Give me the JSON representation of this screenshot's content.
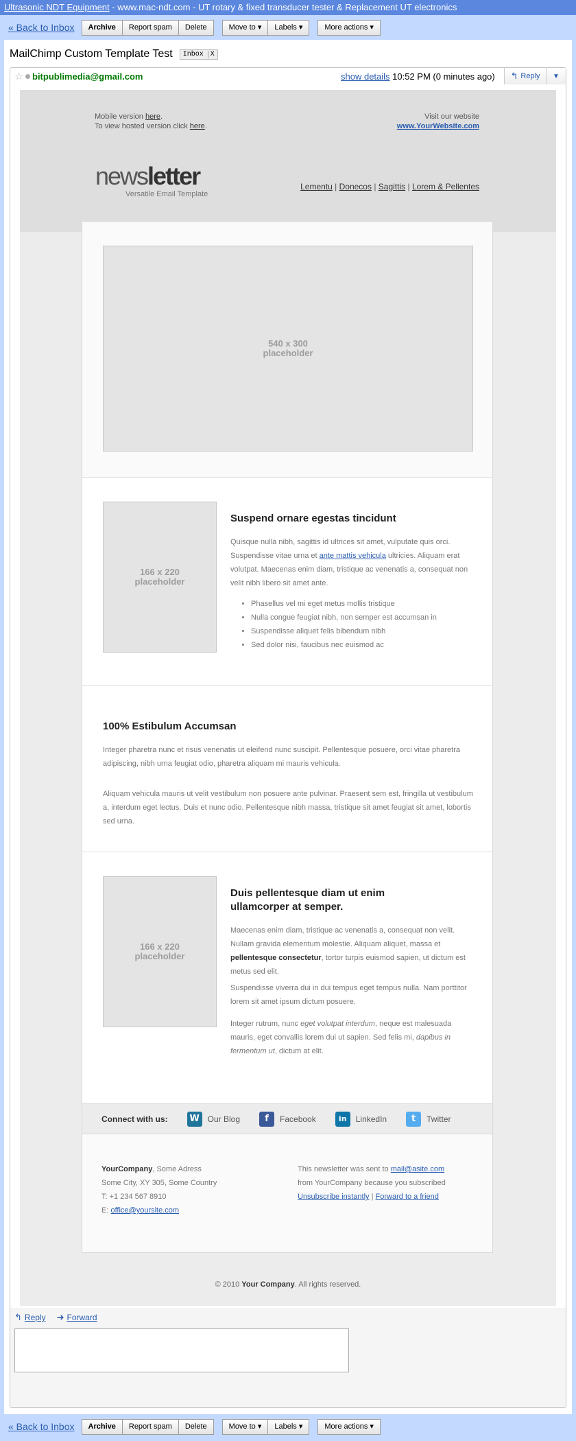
{
  "ad": {
    "link": "Ultrasonic NDT Equipment",
    "text": " - www.mac-ndt.com - UT rotary & fixed transducer tester & Replacement UT electronics"
  },
  "toolbar": {
    "back": "« Back to Inbox",
    "archive": "Archive",
    "spam": "Report spam",
    "delete": "Delete",
    "move": "Move to ▾",
    "labels": "Labels ▾",
    "more": "More actions ▾"
  },
  "message": {
    "subject": "MailChimp Custom Template Test",
    "label": "Inbox",
    "label_close": "X",
    "sender": "bitpublimedia@gmail.com",
    "show_details": "show details",
    "time": " 10:52 PM (0 minutes ago)",
    "reply": "Reply",
    "dropdown": "▼"
  },
  "newsletter": {
    "mobile_prefix": "Mobile version ",
    "mobile_link": "here",
    "mobile_suffix": ".",
    "hosted_prefix": "To view hosted version click ",
    "hosted_link": "here",
    "hosted_suffix": ".",
    "visit": "Visit our website",
    "website": "www.YourWebsite.com",
    "logo_light": "news",
    "logo_bold": "letter",
    "logo_sub": "Versatile Email Template",
    "nav": [
      "Lementu",
      "Donecos",
      "Sagittis",
      "Lorem & Pellentes"
    ],
    "nav_sep": " | ",
    "hero_placeholder": [
      "540 x 300",
      "placeholder"
    ],
    "s1": {
      "placeholder": [
        "166 x 220",
        "placeholder"
      ],
      "title": "Suspend ornare egestas tincidunt",
      "p_a": "Quisque nulla nibh, sagittis id ultrices sit amet, vulputate quis orci. Suspendisse vitae urna et ",
      "p_link": "ante mattis vehicula",
      "p_b": " ultricies. Aliquam erat volutpat. Maecenas enim diam, tristique ac venenatis a, consequat non velit nibh libero sit amet ante.",
      "bullets": [
        "Phasellus vel mi eget metus mollis tristique",
        "Nulla congue feugiat nibh, non semper est accumsan in",
        "Suspendisse aliquet felis bibendum nibh",
        "Sed dolor nisi, faucibus nec euismod ac"
      ]
    },
    "s2": {
      "title": "100% Estibulum Accumsan",
      "p1": "Integer pharetra nunc et risus venenatis ut eleifend nunc suscipit. Pellentesque posuere, orci vitae pharetra adipiscing, nibh urna feugiat odio, pharetra aliquam mi mauris vehicula.",
      "p2": "Aliquam vehicula mauris ut velit vestibulum non posuere ante pulvinar. Praesent sem est, fringilla ut vestibulum a, interdum eget lectus. Duis et nunc odio. Pellentesque nibh massa, tristique sit amet feugiat sit amet, lobortis sed urna."
    },
    "s3": {
      "placeholder": [
        "166 x 220",
        "placeholder"
      ],
      "title": "Duis pellentesque diam ut enim ullamcorper at semper.",
      "p1_a": "Maecenas enim diam, tristique ac venenatis a, consequat non velit. Nullam gravida elementum molestie. Aliquam aliquet, massa et ",
      "p1_bold": "pellentesque consectetur",
      "p1_b": ", tortor turpis euismod sapien, ut dictum est metus sed elit.",
      "p2": "Suspendisse viverra dui in dui tempus eget tempus nulla. Nam porttitor lorem sit amet ipsum dictum posuere.",
      "p3_a": "Integer rutrum, nunc ",
      "p3_i1": "eget volutpat interdum",
      "p3_b": ", neque est malesuada mauris, eget convallis lorem dui ut sapien. Sed felis mi, ",
      "p3_i2": "dapibus in fermentum ut",
      "p3_c": ", dictum at elit."
    },
    "social": {
      "connect": "Connect with us:",
      "items": [
        {
          "label": "Our Blog",
          "icon": "wordpress-icon",
          "glyph": "W",
          "color": "#21759b"
        },
        {
          "label": "Facebook",
          "icon": "facebook-icon",
          "glyph": "f",
          "color": "#3b5998"
        },
        {
          "label": "LinkedIn",
          "icon": "linkedin-icon",
          "glyph": "in",
          "color": "#0e76a8"
        },
        {
          "label": "Twitter",
          "icon": "twitter-icon",
          "glyph": "t",
          "color": "#55acee"
        }
      ]
    },
    "footer": {
      "company": "YourCompany",
      "address1": ", Some Adress",
      "address2": "Some City, XY 305, Some Country",
      "phone": "T: +1 234 567 8910",
      "email_prefix": "E: ",
      "email": "office@yoursite.com",
      "sent_prefix": "This newsletter was sent to ",
      "sent_email": "mail@asite.com",
      "sent_line2": "from YourCompany because you subscribed",
      "unsubscribe": "Unsubscribe instantly",
      "sep": " | ",
      "forward": "Forward to a friend"
    },
    "copyright_a": "© 2010 ",
    "copyright_b": "Your Company",
    "copyright_c": ". All rights reserved."
  },
  "reply_area": {
    "reply": "Reply",
    "forward": "Forward"
  }
}
